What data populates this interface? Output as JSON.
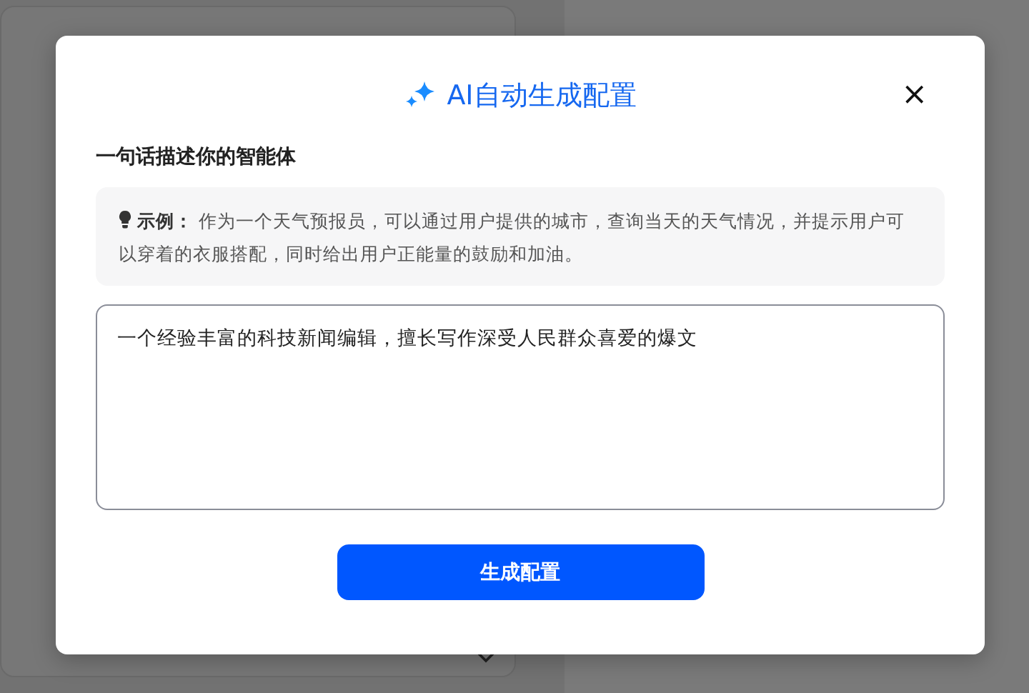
{
  "dialog": {
    "title": "AI自动生成配置",
    "close": "×",
    "prompt_label": "一句话描述你的智能体",
    "example": "**示例：** 作为一个天气预报员，可以通过用户提供的城市，查询当天的天气情况，并提示用户可以穿着的衣服搭配，同时给出用户正能量的鼓励和加油。",
    "description": {
      "value": "一个经验丰富的科技新闻编辑，擅长写作深受人民群众喜爱的爆文"
    },
    "button": "生成配置"
  }
}
